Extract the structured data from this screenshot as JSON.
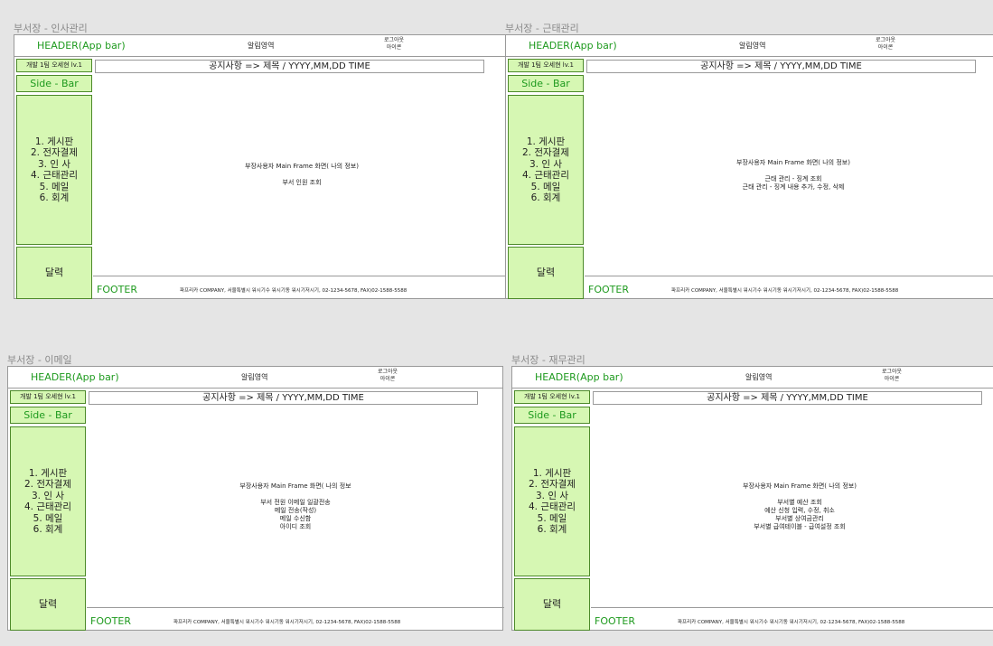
{
  "frames": [
    {
      "label": "부서장 - 인사관리",
      "header": {
        "title": "HEADER(App bar)",
        "alert": "알림영역",
        "logout_line1": "로그아웃",
        "logout_line2": "아이콘"
      },
      "user": "개발 1팀 오세현 lv.1",
      "sidebar_title": "Side - Bar",
      "menu": [
        "1. 게시판",
        "2. 전자결제",
        "3. 인 사",
        "4. 근태관리",
        "5. 메일",
        "6. 회계"
      ],
      "calendar": "달력",
      "notice": "공지사항 => 제목 / YYYY,MM,DD TIME",
      "main_title": "부장사용자 Main Frame 화면( 나의 정보)",
      "main_lines": [
        "부서 인원 조회"
      ],
      "footer": {
        "title": "FOOTER",
        "info": "파프리카 COMPANY, 서울특별시 워시기수 워시기동 워시기저시기, 02-1234-5678, FAX)02-1588-5588"
      }
    },
    {
      "label": "부서장 - 근태관리",
      "header": {
        "title": "HEADER(App bar)",
        "alert": "알림영역",
        "logout_line1": "로그아웃",
        "logout_line2": "아이콘"
      },
      "user": "개발 1팀 오세현 lv.1",
      "sidebar_title": "Side - Bar",
      "menu": [
        "1. 게시판",
        "2. 전자결제",
        "3. 인 사",
        "4. 근태관리",
        "5. 메일",
        "6. 회계"
      ],
      "calendar": "달력",
      "notice": "공지사항 => 제목 / YYYY,MM,DD TIME",
      "main_title": "부장사용자 Main Frame 화면( 나의 정보)",
      "main_lines": [
        "근태 관리 - 징계 조회",
        "근태 관리 - 징계 내용 추가, 수정, 삭제"
      ],
      "footer": {
        "title": "FOOTER",
        "info": "파프리카 COMPANY, 서울특별시 워시기수 워시기동 워시기저시기, 02-1234-5678, FAX)02-1588-5588"
      }
    },
    {
      "label": "부서장 - 이메일",
      "header": {
        "title": "HEADER(App bar)",
        "alert": "알림영역",
        "logout_line1": "로그아웃",
        "logout_line2": "아이콘"
      },
      "user": "개발 1팀 오세현 lv.1",
      "sidebar_title": "Side - Bar",
      "menu": [
        "1. 게시판",
        "2. 전자결제",
        "3. 인 사",
        "4. 근태관리",
        "5. 메일",
        "6. 회계"
      ],
      "calendar": "달력",
      "notice": "공지사항 => 제목 / YYYY,MM,DD TIME",
      "main_title": "부장사용자 Main Frame 화면( 나의 정보",
      "main_lines": [
        "부서 전원 이메일 일괄전송",
        "메일 전송(작성)",
        "메일 수신함",
        "아이디 조회"
      ],
      "footer": {
        "title": "FOOTER",
        "info": "파프리카 COMPANY, 서울특별시 워시기수 워시기동 워시기저시기, 02-1234-5678, FAX)02-1588-5588"
      }
    },
    {
      "label": "부서장 - 재무관리",
      "header": {
        "title": "HEADER(App bar)",
        "alert": "알림영역",
        "logout_line1": "로그아웃",
        "logout_line2": "아이콘"
      },
      "user": "개발 1팀 오세현 lv.1",
      "sidebar_title": "Side - Bar",
      "menu": [
        "1. 게시판",
        "2. 전자결제",
        "3. 인 사",
        "4. 근태관리",
        "5. 메일",
        "6. 회계"
      ],
      "calendar": "달력",
      "notice": "공지사항 => 제목 / YYYY,MM,DD TIME",
      "main_title": "부장사용자 Main Frame 화면( 나의 정보)",
      "main_lines": [
        "부서별 예산 조회",
        "예산 신청 입력, 수정, 취소",
        "부서별 상여금관리",
        "부서별 급여테이블 - 급여설정 조회"
      ],
      "footer": {
        "title": "FOOTER",
        "info": "파프리카 COMPANY, 서울특별시 워시기수 워시기동 워시기저시기, 02-1234-5678, FAX)02-1588-5588"
      }
    }
  ]
}
